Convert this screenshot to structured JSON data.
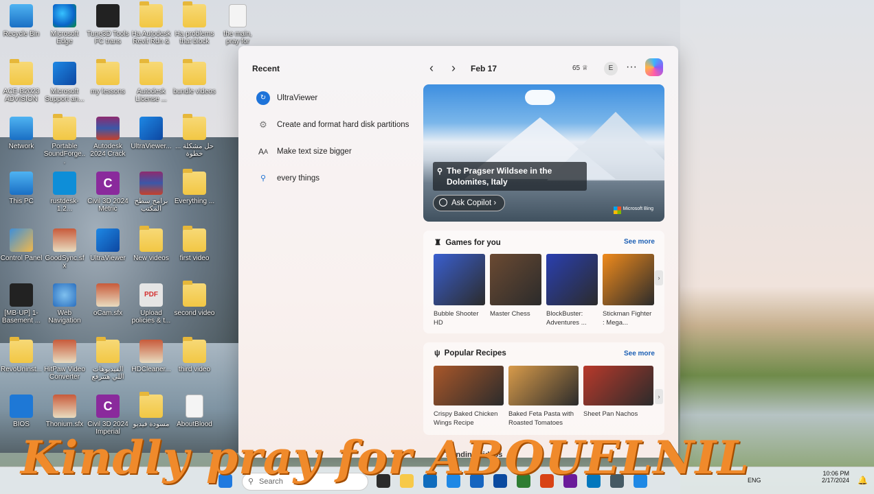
{
  "desktop": {
    "icons": [
      {
        "label": "Recycle Bin",
        "icon": "recycle-bin-icon"
      },
      {
        "label": "Microsoft Edge",
        "icon": "edge-icon"
      },
      {
        "label": "Tune3D Tools FC trans",
        "icon": "app-icon"
      },
      {
        "label": "Ha Autodesk Revit Rdn &",
        "icon": "folder-icon"
      },
      {
        "label": "Ha problems that block",
        "icon": "folder-icon"
      },
      {
        "label": "the main, pray for",
        "icon": "document-icon"
      },
      {
        "label": "ACE-B2023 ADVISION",
        "icon": "user-icon"
      },
      {
        "label": "Microsoft Support an...",
        "icon": "support-icon"
      },
      {
        "label": "my lessons",
        "icon": "folder-icon"
      },
      {
        "label": "Autodesk License ...",
        "icon": "folder-icon"
      },
      {
        "label": "bundle videos",
        "icon": "folder-icon"
      },
      {
        "label": "Network",
        "icon": "network-icon"
      },
      {
        "label": "Portable SoundForge...",
        "icon": "folder-icon"
      },
      {
        "label": "Autodesk 2024 Crack",
        "icon": "winrar-icon"
      },
      {
        "label": "UltraViewer...",
        "icon": "installer-icon"
      },
      {
        "label": "حل مشكلة ... خطوة",
        "icon": "folder-icon"
      },
      {
        "label": "This PC",
        "icon": "this-pc-icon"
      },
      {
        "label": "rustdesk-1.2...",
        "icon": "rustdesk-icon"
      },
      {
        "label": "Civil 3D 2024 Metric",
        "icon": "civil3d-icon"
      },
      {
        "label": "برامج سطح المكتب",
        "icon": "winrar-icon"
      },
      {
        "label": "Everything ...",
        "icon": "folder-icon"
      },
      {
        "label": "Control Panel",
        "icon": "control-panel-icon"
      },
      {
        "label": "GoodSync.sfx",
        "icon": "package-icon"
      },
      {
        "label": "UltraViewer",
        "icon": "ultraviewer-icon"
      },
      {
        "label": "New videos",
        "icon": "folder-icon"
      },
      {
        "label": "first video",
        "icon": "folder-icon"
      },
      {
        "label": "[MB-UP] 1- Basement ...",
        "icon": "app-icon"
      },
      {
        "label": "Web Navigation",
        "icon": "globe-icon"
      },
      {
        "label": "oCam.sfx",
        "icon": "package-icon"
      },
      {
        "label": "Upload policies & t...",
        "icon": "pdf-icon"
      },
      {
        "label": "second video",
        "icon": "folder-icon"
      },
      {
        "label": "RevoUninst...",
        "icon": "folder-icon"
      },
      {
        "label": "HitPaw Video Converter",
        "icon": "package-icon"
      },
      {
        "label": "الفيديوهات اللي هتترفع",
        "icon": "folder-icon"
      },
      {
        "label": "HDCleaner...",
        "icon": "package-icon"
      },
      {
        "label": "third video",
        "icon": "folder-icon"
      },
      {
        "label": "BIOS",
        "icon": "bios-icon"
      },
      {
        "label": "Thonium.sfx",
        "icon": "package-icon"
      },
      {
        "label": "Civil 3D 2024 Imperial",
        "icon": "civil3d-icon"
      },
      {
        "label": "مسودة فيديو",
        "icon": "folder-icon"
      },
      {
        "label": "AboutBlood",
        "icon": "document-icon"
      }
    ]
  },
  "widgets": {
    "recent_title": "Recent",
    "recent": [
      {
        "label": "UltraViewer",
        "icon": "ultraviewer-icon"
      },
      {
        "label": "Create and format hard disk partitions",
        "icon": "gear-icon"
      },
      {
        "label": "Make text size bigger",
        "icon": "text-size-icon"
      },
      {
        "label": "every things",
        "icon": "search-icon"
      }
    ],
    "date": "Feb 17",
    "points": "65",
    "avatar_initial": "E",
    "hero": {
      "caption": "The Pragser Wildsee in the Dolomites, Italy",
      "ask_copilot": "Ask Copilot",
      "brand": "Microsoft Bing"
    },
    "games": {
      "title": "Games for you",
      "see_more": "See more",
      "items": [
        {
          "label": "Bubble Shooter HD",
          "color": "#3a5fcf"
        },
        {
          "label": "Master Chess",
          "color": "#6b4a32"
        },
        {
          "label": "BlockBuster: Adventures ...",
          "color": "#2a3fb0"
        },
        {
          "label": "Stickman Fighter : Mega...",
          "color": "#f08b1c"
        }
      ]
    },
    "recipes": {
      "title": "Popular Recipes",
      "see_more": "See more",
      "items": [
        {
          "label": "Crispy Baked Chicken Wings Recipe",
          "color": "#a9572a"
        },
        {
          "label": "Baked Feta Pasta with Roasted Tomatoes",
          "color": "#d89b4a"
        },
        {
          "label": "Sheet Pan Nachos",
          "color": "#b8392b"
        }
      ]
    },
    "trending_partial": "Trending videos"
  },
  "taskbar": {
    "search_placeholder": "Search",
    "lang": "ENG",
    "time": "10:06 PM",
    "date": "2/17/2024"
  },
  "overlay_banner": "Kindly pray for ABOUELNIL"
}
